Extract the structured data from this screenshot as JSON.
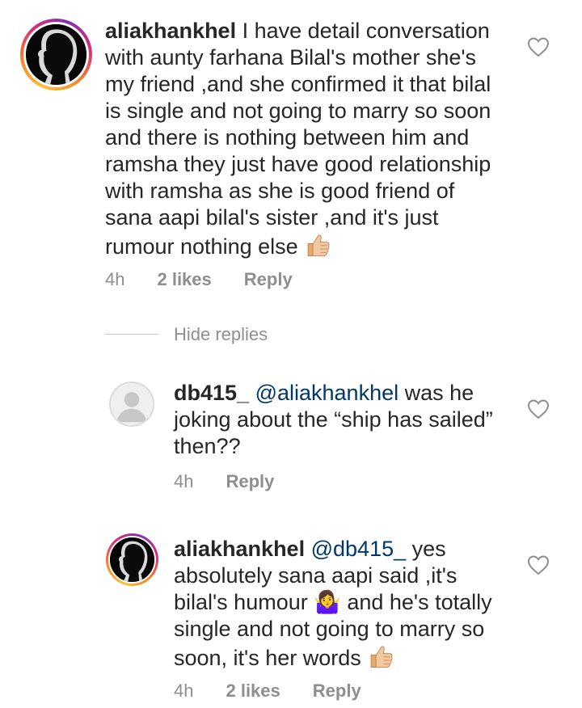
{
  "comments": [
    {
      "username": "aliakhankhel",
      "mention": "",
      "text": "I have detail conversation with aunty farhana Bilal's mother she's my friend ,and she confirmed it that bilal is single and not going to marry so soon and there is nothing between him and ramsha they just have good relationship with ramsha as she is good friend of sana aapi bilal's sister ,and it's just rumour nothing else",
      "emoji": "thumbs-up",
      "time": "4h",
      "likes": "2 likes",
      "reply_label": "Reply"
    }
  ],
  "replies_toggle": {
    "label": "Hide replies"
  },
  "replies": [
    {
      "username": "db415_",
      "mention": "@aliakhankhel",
      "text": "was he joking about the “ship has sailed” then??",
      "time": "4h",
      "likes": "",
      "reply_label": "Reply"
    },
    {
      "username": "aliakhankhel",
      "mention": "@db415_",
      "text": "yes absolutely sana aapi said ,it's bilal's humour 🤷‍♀️ and he's totally single and not going to marry so soon, it's her words",
      "emoji": "thumbs-up",
      "time": "4h",
      "likes": "2 likes",
      "reply_label": "Reply"
    }
  ],
  "icons": {
    "like": "heart-outline-icon",
    "emoji": "thumbs-up-emoji",
    "avatar_default": "default-avatar-icon"
  },
  "colors": {
    "text": "#262626",
    "muted": "#8e8e8e",
    "mention": "#00376b",
    "divider": "#c7c7c7"
  }
}
